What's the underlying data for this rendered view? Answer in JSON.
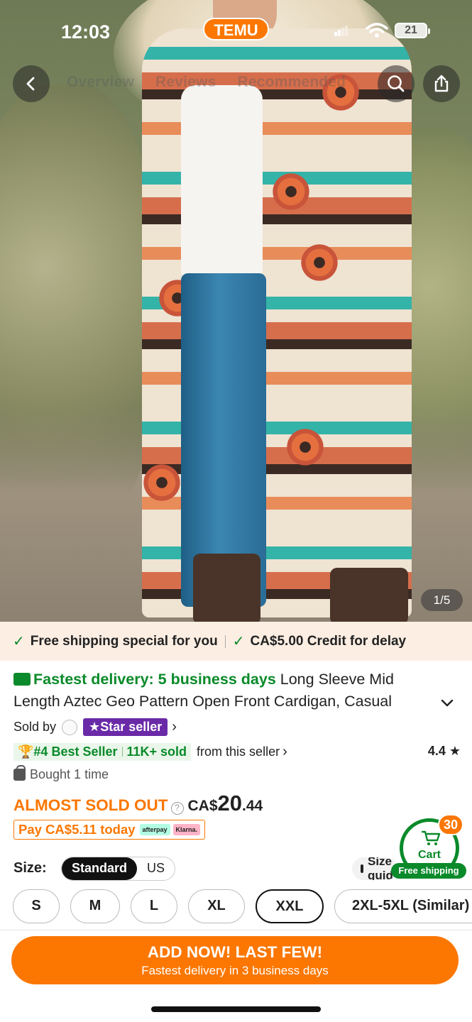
{
  "status_bar": {
    "time": "12:03",
    "app_badge": "TEMU",
    "battery": "21"
  },
  "nav": {
    "tabs": [
      "Overview",
      "Reviews",
      "Recommended"
    ]
  },
  "image_counter": "1/5",
  "promo_bar": {
    "item1": "Free shipping special for you",
    "item2": "CA$5.00 Credit for delay"
  },
  "product": {
    "delivery_label": "Fastest delivery: 5 business days",
    "title": "Long Sleeve Mid Length Aztec Geo Pattern Open Front Cardigan, Casual",
    "sold_by_label": "Sold by",
    "star_seller": "Star seller",
    "best_seller": "#4 Best Seller",
    "sold_count": "11K+ sold",
    "from_seller": "from this seller",
    "rating": "4.4",
    "bought": "Bought 1 time",
    "almost_sold_out": "ALMOST SOLD OUT",
    "price_currency": "CA$",
    "price_int": "20",
    "price_dec": ".44",
    "pay_today": "Pay CA$5.11 today",
    "afterpay": "afterpay",
    "klarna": "Klarna."
  },
  "cart": {
    "count": "30",
    "label": "Cart",
    "free_shipping": "Free shipping"
  },
  "size": {
    "label": "Size:",
    "toggle": [
      "Standard",
      "US"
    ],
    "guide": "Size guide",
    "options": [
      "S",
      "M",
      "L",
      "XL",
      "XXL",
      "2XL-5XL (Similar)"
    ],
    "selected": "XXL"
  },
  "cta": {
    "line1": "ADD NOW! LAST FEW!",
    "line2": "Fastest delivery in 3 business days"
  },
  "colors": {
    "accent": "#fb7701",
    "green": "#0a8a2a",
    "star_seller": "#6a2aa8"
  }
}
